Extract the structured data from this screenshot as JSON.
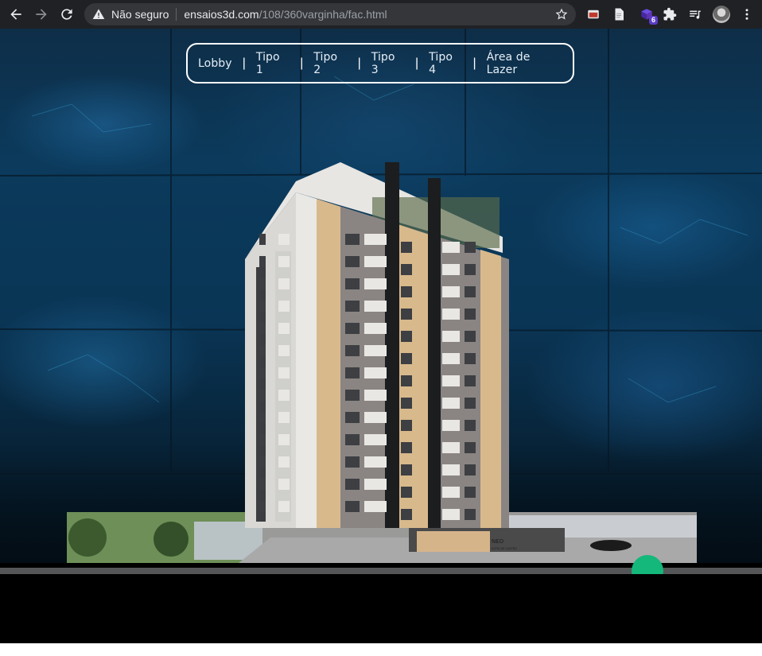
{
  "browser": {
    "security_label": "Não seguro",
    "url_host": "ensaios3d.com",
    "url_path": "/108/360varginha/fac.html",
    "extension_badge": "6"
  },
  "menu": {
    "items": [
      {
        "label": "Lobby"
      },
      {
        "label": "Tipo 1"
      },
      {
        "label": "Tipo 2"
      },
      {
        "label": "Tipo 3"
      },
      {
        "label": "Tipo 4"
      },
      {
        "label": "Área de Lazer"
      }
    ],
    "separator": "|"
  },
  "building": {
    "sign_title": "NEO",
    "sign_subtitle": "SOFIA DE CASTRO"
  },
  "slider": {
    "value_fraction": 0.85,
    "thumb_color": "#14b87a",
    "track_color": "#555657"
  },
  "icons": [
    "back-arrow-icon",
    "forward-arrow-icon",
    "reload-icon",
    "warning-icon",
    "star-icon",
    "cast-icon",
    "document-icon",
    "extension-badge-icon",
    "puzzle-icon",
    "media-queue-icon",
    "menu-dots-icon"
  ]
}
